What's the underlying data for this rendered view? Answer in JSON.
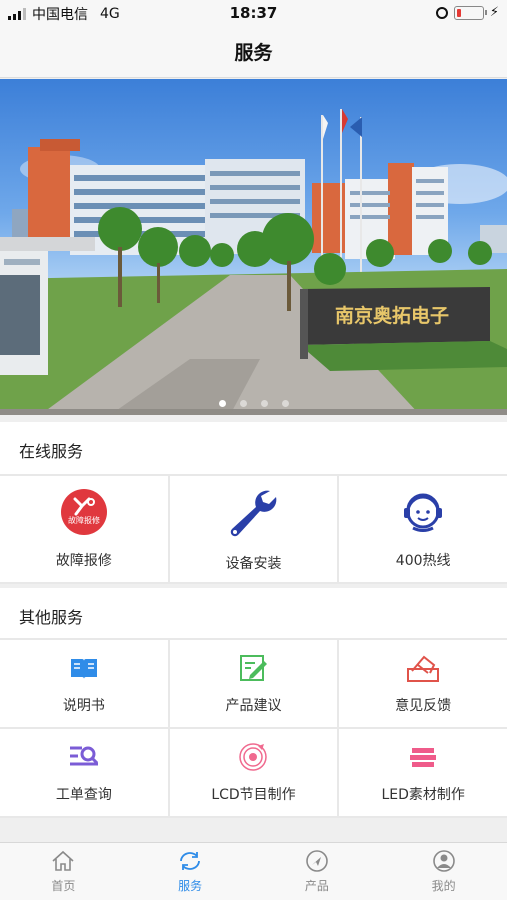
{
  "status_bar": {
    "carrier": "中国电信",
    "network": "4G",
    "time": "18:37"
  },
  "nav": {
    "title": "服务"
  },
  "banner": {
    "sign_text": "南京奥拓电子",
    "slides": 4,
    "active_slide": 1
  },
  "online_services": {
    "heading": "在线服务",
    "items": [
      {
        "label": "故障报修",
        "icon": "repair-badge-icon",
        "badge_text": "故障报修",
        "color": "#e0383e"
      },
      {
        "label": "设备安装",
        "icon": "wrench-icon",
        "color": "#2a3fa8"
      },
      {
        "label": "400热线",
        "icon": "headset-agent-icon",
        "color": "#2a3fa8"
      }
    ]
  },
  "other_services": {
    "heading": "其他服务",
    "items": [
      {
        "label": "说明书",
        "icon": "book-icon",
        "color": "#2f8ce8"
      },
      {
        "label": "产品建议",
        "icon": "edit-note-icon",
        "color": "#4cbc5c"
      },
      {
        "label": "意见反馈",
        "icon": "feedback-envelope-icon",
        "color": "#e0534a"
      },
      {
        "label": "工单查询",
        "icon": "search-list-icon",
        "color": "#7b5cd6"
      },
      {
        "label": "LCD节目制作",
        "icon": "disc-icon",
        "color": "#f06a8f"
      },
      {
        "label": "LED素材制作",
        "icon": "layers-icon",
        "color": "#ef5b8a"
      }
    ]
  },
  "tab_bar": {
    "tabs": [
      {
        "label": "首页",
        "icon": "home-icon",
        "active": false
      },
      {
        "label": "服务",
        "icon": "refresh-icon",
        "active": true
      },
      {
        "label": "产品",
        "icon": "compass-icon",
        "active": false
      },
      {
        "label": "我的",
        "icon": "user-icon",
        "active": false
      }
    ]
  },
  "colors": {
    "accent": "#2f8ce8",
    "tab_inactive": "#8a8a8a"
  }
}
